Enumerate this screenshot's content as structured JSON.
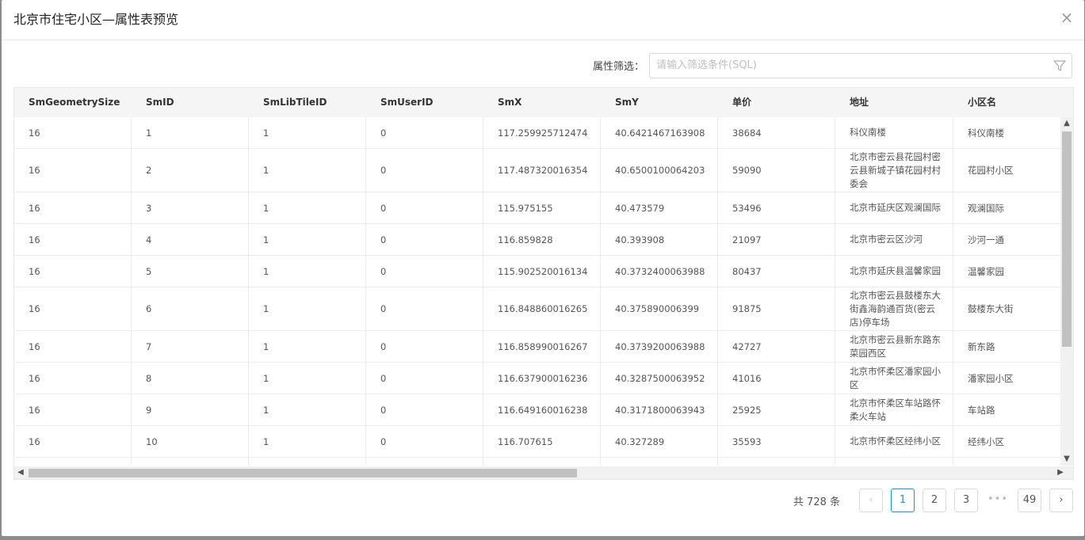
{
  "modal": {
    "title": "北京市住宅小区—属性表预览",
    "close": "×"
  },
  "filter": {
    "label": "属性筛选：",
    "placeholder": "请输入筛选条件(SQL)"
  },
  "table": {
    "columns": [
      "SmGeometrySize",
      "SmID",
      "SmLibTileID",
      "SmUserID",
      "SmX",
      "SmY",
      "单价",
      "地址",
      "小区名"
    ],
    "rows": [
      [
        "16",
        "1",
        "1",
        "0",
        "117.259925712474",
        "40.6421467163908",
        "38684",
        "科仪南楼",
        "科仪南楼"
      ],
      [
        "16",
        "2",
        "1",
        "0",
        "117.487320016354",
        "40.6500100064203",
        "59090",
        "北京市密云县花园村密云县新城子镇花园村村委会",
        "花园村小区"
      ],
      [
        "16",
        "3",
        "1",
        "0",
        "115.975155",
        "40.473579",
        "53496",
        "北京市延庆区观澜国际",
        "观澜国际"
      ],
      [
        "16",
        "4",
        "1",
        "0",
        "116.859828",
        "40.393908",
        "21097",
        "北京市密云区沙河",
        "沙河一通"
      ],
      [
        "16",
        "5",
        "1",
        "0",
        "115.902520016134",
        "40.3732400063988",
        "80437",
        "北京市延庆县温馨家园",
        "温馨家园"
      ],
      [
        "16",
        "6",
        "1",
        "0",
        "116.848860016265",
        "40.375890006399",
        "91875",
        "北京市密云县鼓楼东大街鑫海韵通百货(密云店)停车场",
        "鼓楼东大街"
      ],
      [
        "16",
        "7",
        "1",
        "0",
        "116.858990016267",
        "40.3739200063988",
        "42727",
        "北京市密云县新东路东菜园西区",
        "新东路"
      ],
      [
        "16",
        "8",
        "1",
        "0",
        "116.637900016236",
        "40.3287500063952",
        "41016",
        "北京市怀柔区潘家园小区",
        "潘家园小区"
      ],
      [
        "16",
        "9",
        "1",
        "0",
        "116.649160016238",
        "40.3171800063943",
        "25925",
        "北京市怀柔区车站路怀柔火车站",
        "车站路"
      ],
      [
        "16",
        "10",
        "1",
        "0",
        "116.707615",
        "40.327289",
        "35593",
        "北京市怀柔区经纬小区",
        "经纬小区"
      ]
    ]
  },
  "pagination": {
    "total": "共 728 条",
    "prev": "‹",
    "pages": [
      "1",
      "2",
      "3"
    ],
    "ellipsis": "•••",
    "last": "49",
    "next": "›",
    "current": "1"
  },
  "colors": {
    "accent": "#1890ff",
    "header_bg": "#f5f5f5"
  }
}
